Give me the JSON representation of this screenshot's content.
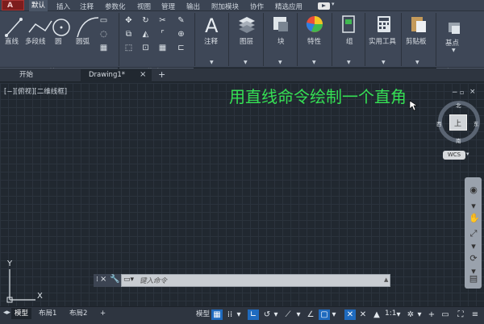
{
  "menu": {
    "app_button": "A",
    "items": [
      "默认",
      "插入",
      "注释",
      "参数化",
      "视图",
      "管理",
      "输出",
      "附加模块",
      "协作",
      "精选应用"
    ],
    "active_index": 0
  },
  "ribbon": {
    "draw": {
      "tools": [
        "直线",
        "多段线",
        "圆",
        "圆弧"
      ],
      "panel_label": "绘图"
    },
    "modify": {
      "panel_label": "修改"
    },
    "big_buttons": [
      "注释",
      "图层",
      "块",
      "特性",
      "组",
      "实用工具",
      "剪贴板"
    ],
    "view": {
      "tool": "基点",
      "panel_label": "视图"
    }
  },
  "tabs": {
    "start": "开始",
    "drawing": "Drawing1*",
    "close": "×",
    "add": "+"
  },
  "canvas": {
    "view_label": "[−][俯视][二维线框]",
    "headline": "用直线命令绘制一个直角",
    "viewcube": {
      "north": "北",
      "south": "南",
      "east": "东",
      "west": "西",
      "top": "上"
    },
    "wcs": "WCS",
    "ucs_y": "Y",
    "ucs_x": "X"
  },
  "command_line": {
    "placeholder": "键入命令"
  },
  "status": {
    "layout_tabs": [
      "模型",
      "布局1",
      "布局2"
    ],
    "add": "+",
    "model_label": "模型",
    "scale": "1:1"
  },
  "colors": {
    "headline": "#35e054",
    "accent": "#1f6bbf"
  }
}
